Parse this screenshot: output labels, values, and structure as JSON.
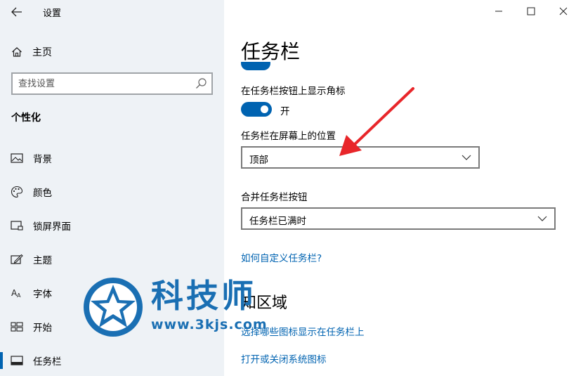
{
  "app": {
    "title": "设置"
  },
  "sidebar": {
    "home_label": "主页",
    "search_placeholder": "查找设置",
    "section_title": "个性化",
    "items": [
      {
        "label": "背景",
        "icon": "picture-icon"
      },
      {
        "label": "颜色",
        "icon": "palette-icon"
      },
      {
        "label": "锁屏界面",
        "icon": "lock-screen-icon"
      },
      {
        "label": "主题",
        "icon": "theme-icon"
      },
      {
        "label": "字体",
        "icon": "font-icon"
      },
      {
        "label": "开始",
        "icon": "start-icon"
      },
      {
        "label": "任务栏",
        "icon": "taskbar-icon",
        "active": true
      }
    ]
  },
  "main": {
    "page_title": "任务栏",
    "badge_setting": {
      "label": "在任务栏按钮上显示角标",
      "state": "开",
      "on": true
    },
    "position_setting": {
      "label": "任务栏在屏幕上的位置",
      "value": "顶部"
    },
    "combine_setting": {
      "label": "合并任务栏按钮",
      "value": "任务栏已满时"
    },
    "customize_link": "如何自定义任务栏?",
    "notification_heading": "知区域",
    "link_select_icons": "选择哪些图标显示在任务栏上",
    "link_system_icons": "打开或关闭系统图标"
  },
  "watermark": {
    "brand": "科技师",
    "url": "www.3kjs.com"
  },
  "colors": {
    "accent": "#0063b1",
    "sidebar_bg": "#eef2f6",
    "arrow": "#e8262a",
    "watermark": "#1a6fb3"
  }
}
